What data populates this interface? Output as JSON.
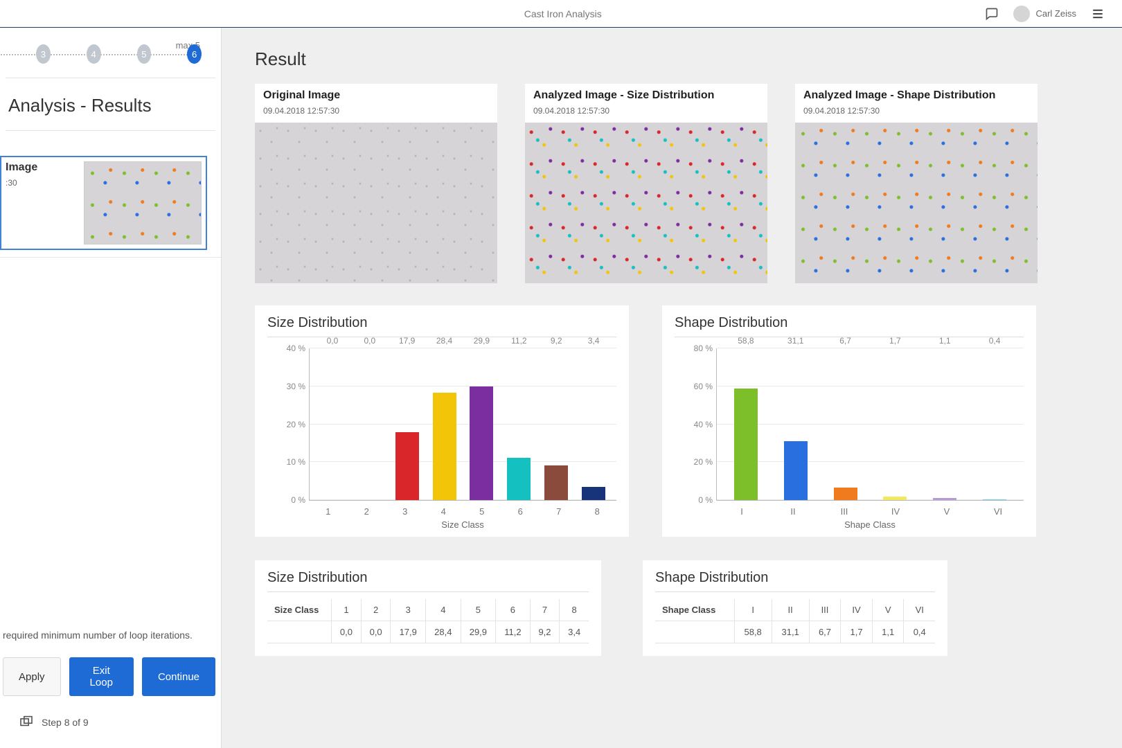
{
  "topbar": {
    "title": "Cast Iron Analysis",
    "user": "Carl Zeiss"
  },
  "stepper": {
    "max_label": "max 5",
    "steps": [
      "3",
      "4",
      "5",
      "6"
    ],
    "active_index": 3
  },
  "sidebar": {
    "section_title": "Analysis - Results",
    "thumb": {
      "title": "Image",
      "time": ":30"
    },
    "hint": "required minimum number of loop iterations.",
    "apply": "Apply",
    "exit": "Exit Loop",
    "continue": "Continue",
    "step_footer": "Step 8 of 9"
  },
  "page": {
    "heading": "Result"
  },
  "image_cards": [
    {
      "title": "Original Image",
      "time": "09.04.2018 12:57:30",
      "variant": ""
    },
    {
      "title": "Analyzed Image - Size Distribution",
      "time": "09.04.2018 12:57:30",
      "variant": "color1"
    },
    {
      "title": "Analyzed Image - Shape Distribution",
      "time": "09.04.2018 12:57:30",
      "variant": "color2"
    }
  ],
  "chart_data": [
    {
      "id": "size",
      "type": "bar",
      "title": "Size Distribution",
      "xlabel": "Size Class",
      "ylabel": "",
      "categories": [
        "1",
        "2",
        "3",
        "4",
        "5",
        "6",
        "7",
        "8"
      ],
      "values": [
        0.0,
        0.0,
        17.9,
        28.4,
        29.9,
        11.2,
        9.2,
        3.4
      ],
      "value_labels": [
        "0,0",
        "0,0",
        "17,9",
        "28,4",
        "29,9",
        "11,2",
        "9,2",
        "3,4"
      ],
      "colors": [
        "#bdbdbd",
        "#bdbdbd",
        "#d9262a",
        "#f2c508",
        "#7b2ea0",
        "#14c0c0",
        "#8a4b3d",
        "#17347a"
      ],
      "ylim": [
        0,
        40
      ],
      "yticks": [
        0,
        10,
        20,
        30,
        40
      ],
      "ytick_labels": [
        "0 %",
        "10 %",
        "20 %",
        "30 %",
        "40 %"
      ]
    },
    {
      "id": "shape",
      "type": "bar",
      "title": "Shape Distribution",
      "xlabel": "Shape Class",
      "ylabel": "",
      "categories": [
        "I",
        "II",
        "III",
        "IV",
        "V",
        "VI"
      ],
      "values": [
        58.8,
        31.1,
        6.7,
        1.7,
        1.1,
        0.4
      ],
      "value_labels": [
        "58,8",
        "31,1",
        "6,7",
        "1,7",
        "1,1",
        "0,4"
      ],
      "colors": [
        "#7cbf2a",
        "#2a6fe0",
        "#f07a1e",
        "#f2e95c",
        "#b79bd8",
        "#6fd3e0"
      ],
      "ylim": [
        0,
        80
      ],
      "yticks": [
        0,
        20,
        40,
        60,
        80
      ],
      "ytick_labels": [
        "0 %",
        "20 %",
        "40 %",
        "60 %",
        "80 %"
      ]
    }
  ],
  "tables": [
    {
      "id": "size",
      "title": "Size Distribution",
      "header_label": "Size Class",
      "columns": [
        "1",
        "2",
        "3",
        "4",
        "5",
        "6",
        "7",
        "8"
      ],
      "row": [
        "0,0",
        "0,0",
        "17,9",
        "28,4",
        "29,9",
        "11,2",
        "9,2",
        "3,4"
      ]
    },
    {
      "id": "shape",
      "title": "Shape Distribution",
      "header_label": "Shape Class",
      "columns": [
        "I",
        "II",
        "III",
        "IV",
        "V",
        "VI"
      ],
      "row": [
        "58,8",
        "31,1",
        "6,7",
        "1,7",
        "1,1",
        "0,4"
      ]
    }
  ]
}
